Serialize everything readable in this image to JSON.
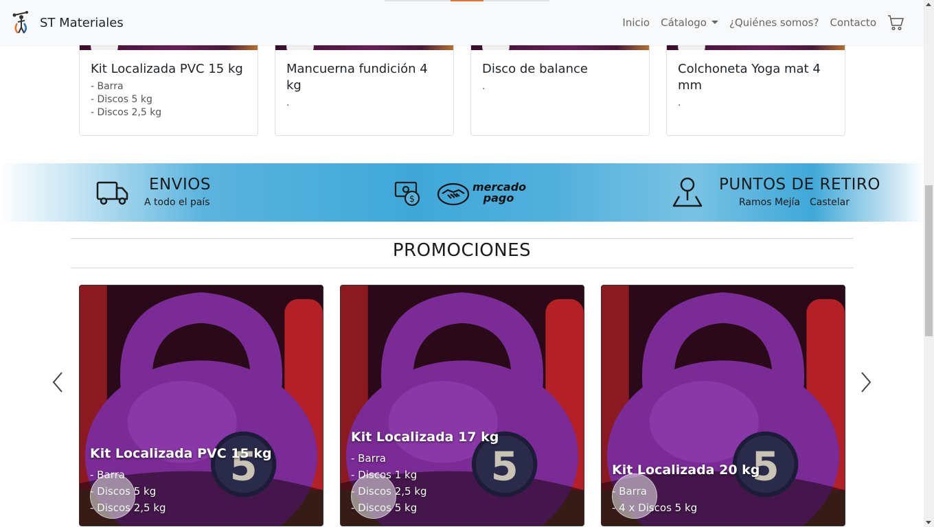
{
  "navbar": {
    "brand_name": "ST Materiales",
    "links": {
      "inicio": "Inicio",
      "catalogo": "Cátalogo",
      "quienes": "¿Quiénes somos?",
      "contacto": "Contacto"
    },
    "accent_color": "#e8702a"
  },
  "top_products": [
    {
      "title": "Kit Localizada PVC 15 kg",
      "lines": [
        "- Barra",
        "- Discos 5 kg",
        "- Discos 2,5 kg"
      ]
    },
    {
      "title": "Mancuerna fundición 4 kg",
      "lines": [
        "."
      ]
    },
    {
      "title": "Disco de balance",
      "lines": [
        "."
      ]
    },
    {
      "title": "Colchoneta Yoga mat 4 mm",
      "lines": [
        "."
      ]
    }
  ],
  "banner": {
    "envios_title": "ENVIOS",
    "envios_subtitle": "A todo el país",
    "mercado_pago_line1": "mercado",
    "mercado_pago_line2": "pago",
    "retiro_title": "PUNTOS DE RETIRO",
    "retiro_places": [
      "Ramos Mejía",
      "Castelar"
    ],
    "color": "#3fa8d8"
  },
  "promociones": {
    "heading": "PROMOCIONES",
    "cards": [
      {
        "title": "Kit Localizada PVC 15 kg",
        "lines": [
          "- Barra",
          "- Discos 5 kg",
          "- Discos 2,5 kg"
        ]
      },
      {
        "title": "Kit Localizada 17 kg",
        "lines": [
          "- Barra",
          "- Discos 1 kg",
          "- Discos 2,5 kg",
          "- Discos 5 kg"
        ]
      },
      {
        "title": "Kit Localizada 20 kg",
        "lines": [
          "- Barra",
          "- 4 x Discos 5 kg"
        ]
      }
    ],
    "kettlebell_number": "5"
  }
}
